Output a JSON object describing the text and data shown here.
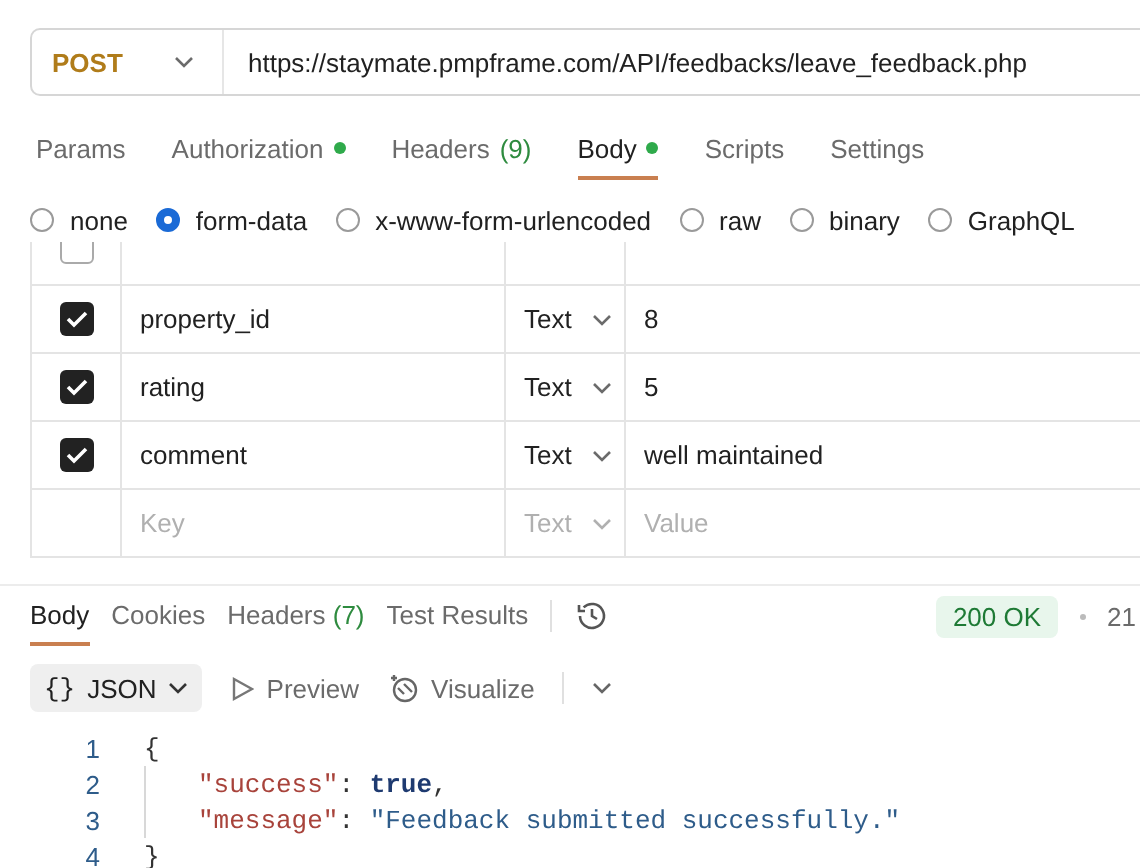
{
  "request": {
    "method": "POST",
    "url": "https://staymate.pmpframe.com/API/feedbacks/leave_feedback.php"
  },
  "request_tabs": [
    {
      "label": "Params",
      "selected": false,
      "dot": false
    },
    {
      "label": "Authorization",
      "selected": false,
      "dot": true
    },
    {
      "label": "Headers",
      "count": "(9)",
      "selected": false,
      "dot": false
    },
    {
      "label": "Body",
      "selected": true,
      "dot": true
    },
    {
      "label": "Scripts",
      "selected": false,
      "dot": false
    },
    {
      "label": "Settings",
      "selected": false,
      "dot": false
    }
  ],
  "body_types": [
    {
      "label": "none",
      "selected": false
    },
    {
      "label": "form-data",
      "selected": true
    },
    {
      "label": "x-www-form-urlencoded",
      "selected": false
    },
    {
      "label": "raw",
      "selected": false
    },
    {
      "label": "binary",
      "selected": false
    },
    {
      "label": "GraphQL",
      "selected": false
    }
  ],
  "form_rows": [
    {
      "kind": "clipped",
      "checked": false
    },
    {
      "kind": "param",
      "checked": true,
      "key": "property_id",
      "type": "Text",
      "value": "8"
    },
    {
      "kind": "param",
      "checked": true,
      "key": "rating",
      "type": "Text",
      "value": "5"
    },
    {
      "kind": "param",
      "checked": true,
      "key": "comment",
      "type": "Text",
      "value": "well maintained"
    },
    {
      "kind": "empty",
      "key_placeholder": "Key",
      "type": "Text",
      "value_placeholder": "Value"
    }
  ],
  "response_tabs": [
    {
      "label": "Body",
      "selected": true
    },
    {
      "label": "Cookies",
      "selected": false
    },
    {
      "label": "Headers",
      "count": "(7)",
      "selected": false
    },
    {
      "label": "Test Results",
      "selected": false
    }
  ],
  "status": {
    "code": "200 OK",
    "time": "21"
  },
  "view": {
    "format_icon": "{}",
    "format": "JSON",
    "preview": "Preview",
    "visualize": "Visualize"
  },
  "code_lines": [
    {
      "number": "1",
      "tokens": [
        {
          "kind": "punct",
          "text": "{"
        }
      ],
      "children": [
        {
          "number": "2",
          "tokens": [
            {
              "kind": "key",
              "text": "\"success\""
            },
            {
              "kind": "punct",
              "text": ": "
            },
            {
              "kind": "bool",
              "text": "true"
            },
            {
              "kind": "punct",
              "text": ","
            }
          ]
        },
        {
          "number": "3",
          "tokens": [
            {
              "kind": "key",
              "text": "\"message\""
            },
            {
              "kind": "punct",
              "text": ": "
            },
            {
              "kind": "string",
              "text": "\"Feedback submitted successfully.\""
            }
          ]
        }
      ]
    },
    {
      "number": "4",
      "tokens": [
        {
          "kind": "punct",
          "text": "}"
        }
      ]
    }
  ]
}
